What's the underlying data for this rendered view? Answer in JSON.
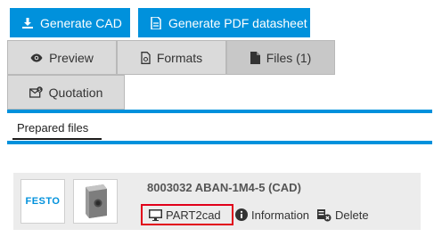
{
  "toolbar": {
    "generate_cad_label": "Generate CAD",
    "generate_pdf_label": "Generate PDF datasheet"
  },
  "tabs": [
    {
      "label": "Preview",
      "icon": "eye-icon"
    },
    {
      "label": "Formats",
      "icon": "document-icon"
    },
    {
      "label": "Files (1)",
      "icon": "file-icon",
      "active": true
    },
    {
      "label": "Quotation",
      "icon": "quotation-icon"
    }
  ],
  "subtab": {
    "label": "Prepared files"
  },
  "file": {
    "logo_text": "FESTO",
    "title": "8003032 ABAN-1M4-5 (CAD)",
    "actions": [
      {
        "label": "PART2cad",
        "icon": "monitor-icon",
        "highlighted": true
      },
      {
        "label": "Information",
        "icon": "info-icon"
      },
      {
        "label": "Delete",
        "icon": "delete-icon"
      }
    ]
  },
  "colors": {
    "accent": "#0091dc",
    "highlight": "#e1001a",
    "tab_bg": "#dadada"
  }
}
